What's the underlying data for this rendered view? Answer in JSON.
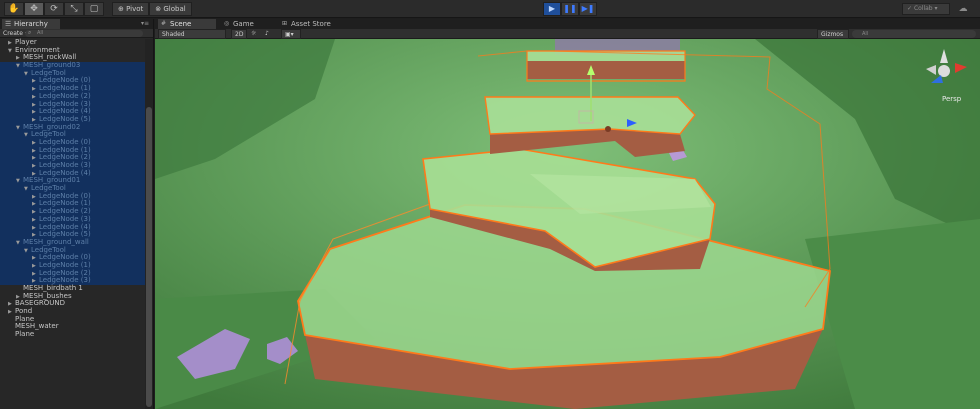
{
  "toolbar": {
    "tools": [
      "hand-tool",
      "move-tool",
      "rotate-tool",
      "scale-tool",
      "rect-tool"
    ],
    "pivot_label": "Pivot",
    "global_label": "Global",
    "play_icons": [
      "play",
      "pause",
      "step"
    ],
    "collab_label": "Collab"
  },
  "hierarchy": {
    "tab_label": "Hierarchy",
    "create_label": "Create",
    "search_placeholder": "All",
    "rows": [
      {
        "label": "Player",
        "indent": 0,
        "arrow": "▶",
        "selected": false
      },
      {
        "label": "Environment",
        "indent": 0,
        "arrow": "▼",
        "selected": false
      },
      {
        "label": "MESH_rockWall",
        "indent": 1,
        "arrow": "▶",
        "selected": false
      },
      {
        "label": "MESH_ground03",
        "indent": 1,
        "arrow": "▼",
        "selected": true
      },
      {
        "label": "LedgeTool",
        "indent": 2,
        "arrow": "▼",
        "selected": true
      },
      {
        "label": "LedgeNode (0)",
        "indent": 3,
        "arrow": "▶",
        "selected": true
      },
      {
        "label": "LedgeNode (1)",
        "indent": 3,
        "arrow": "▶",
        "selected": true
      },
      {
        "label": "LedgeNode (2)",
        "indent": 3,
        "arrow": "▶",
        "selected": true
      },
      {
        "label": "LedgeNode (3)",
        "indent": 3,
        "arrow": "▶",
        "selected": true
      },
      {
        "label": "LedgeNode (4)",
        "indent": 3,
        "arrow": "▶",
        "selected": true
      },
      {
        "label": "LedgeNode (5)",
        "indent": 3,
        "arrow": "▶",
        "selected": true
      },
      {
        "label": "MESH_ground02",
        "indent": 1,
        "arrow": "▼",
        "selected": true
      },
      {
        "label": "LedgeTool",
        "indent": 2,
        "arrow": "▼",
        "selected": true
      },
      {
        "label": "LedgeNode (0)",
        "indent": 3,
        "arrow": "▶",
        "selected": true
      },
      {
        "label": "LedgeNode (1)",
        "indent": 3,
        "arrow": "▶",
        "selected": true
      },
      {
        "label": "LedgeNode (2)",
        "indent": 3,
        "arrow": "▶",
        "selected": true
      },
      {
        "label": "LedgeNode (3)",
        "indent": 3,
        "arrow": "▶",
        "selected": true
      },
      {
        "label": "LedgeNode (4)",
        "indent": 3,
        "arrow": "▶",
        "selected": true
      },
      {
        "label": "MESH_ground01",
        "indent": 1,
        "arrow": "▼",
        "selected": true
      },
      {
        "label": "LedgeTool",
        "indent": 2,
        "arrow": "▼",
        "selected": true
      },
      {
        "label": "LedgeNode (0)",
        "indent": 3,
        "arrow": "▶",
        "selected": true
      },
      {
        "label": "LedgeNode (1)",
        "indent": 3,
        "arrow": "▶",
        "selected": true
      },
      {
        "label": "LedgeNode (2)",
        "indent": 3,
        "arrow": "▶",
        "selected": true
      },
      {
        "label": "LedgeNode (3)",
        "indent": 3,
        "arrow": "▶",
        "selected": true
      },
      {
        "label": "LedgeNode (4)",
        "indent": 3,
        "arrow": "▶",
        "selected": true
      },
      {
        "label": "LedgeNode (5)",
        "indent": 3,
        "arrow": "▶",
        "selected": true
      },
      {
        "label": "MESH_ground_wall",
        "indent": 1,
        "arrow": "▼",
        "selected": true
      },
      {
        "label": "LedgeTool",
        "indent": 2,
        "arrow": "▼",
        "selected": true
      },
      {
        "label": "LedgeNode (0)",
        "indent": 3,
        "arrow": "▶",
        "selected": true
      },
      {
        "label": "LedgeNode (1)",
        "indent": 3,
        "arrow": "▶",
        "selected": true
      },
      {
        "label": "LedgeNode (2)",
        "indent": 3,
        "arrow": "▶",
        "selected": true
      },
      {
        "label": "LedgeNode (3)",
        "indent": 3,
        "arrow": "▶",
        "selected": true
      },
      {
        "label": "MESH_birdbath 1",
        "indent": 1,
        "arrow": "",
        "selected": false
      },
      {
        "label": "MESH_bushes",
        "indent": 1,
        "arrow": "▶",
        "selected": false
      },
      {
        "label": "BASEGROUND",
        "indent": 0,
        "arrow": "▶",
        "selected": false
      },
      {
        "label": "Pond",
        "indent": 0,
        "arrow": "▶",
        "selected": false
      },
      {
        "label": "Plane",
        "indent": 0,
        "arrow": "",
        "selected": false
      },
      {
        "label": "MESH_water",
        "indent": 0,
        "arrow": "",
        "selected": false
      },
      {
        "label": "Plane",
        "indent": 0,
        "arrow": "",
        "selected": false
      }
    ]
  },
  "scene": {
    "tabs": [
      {
        "label": "Scene",
        "icon": "#",
        "active": true
      },
      {
        "label": "Game",
        "icon": "◎",
        "active": false
      },
      {
        "label": "Asset Store",
        "icon": "⊞",
        "active": false
      }
    ],
    "shading_mode": "Shaded",
    "mode_2d": "2D",
    "gizmos_label": "Gizmos",
    "search_placeholder": "All",
    "projection_label": "Persp"
  },
  "colors": {
    "selection": "#12305e",
    "grass": "#7fcf7a",
    "dirt": "#b0664a",
    "outline": "#ff7a1a",
    "accent": "#3e7bff"
  }
}
